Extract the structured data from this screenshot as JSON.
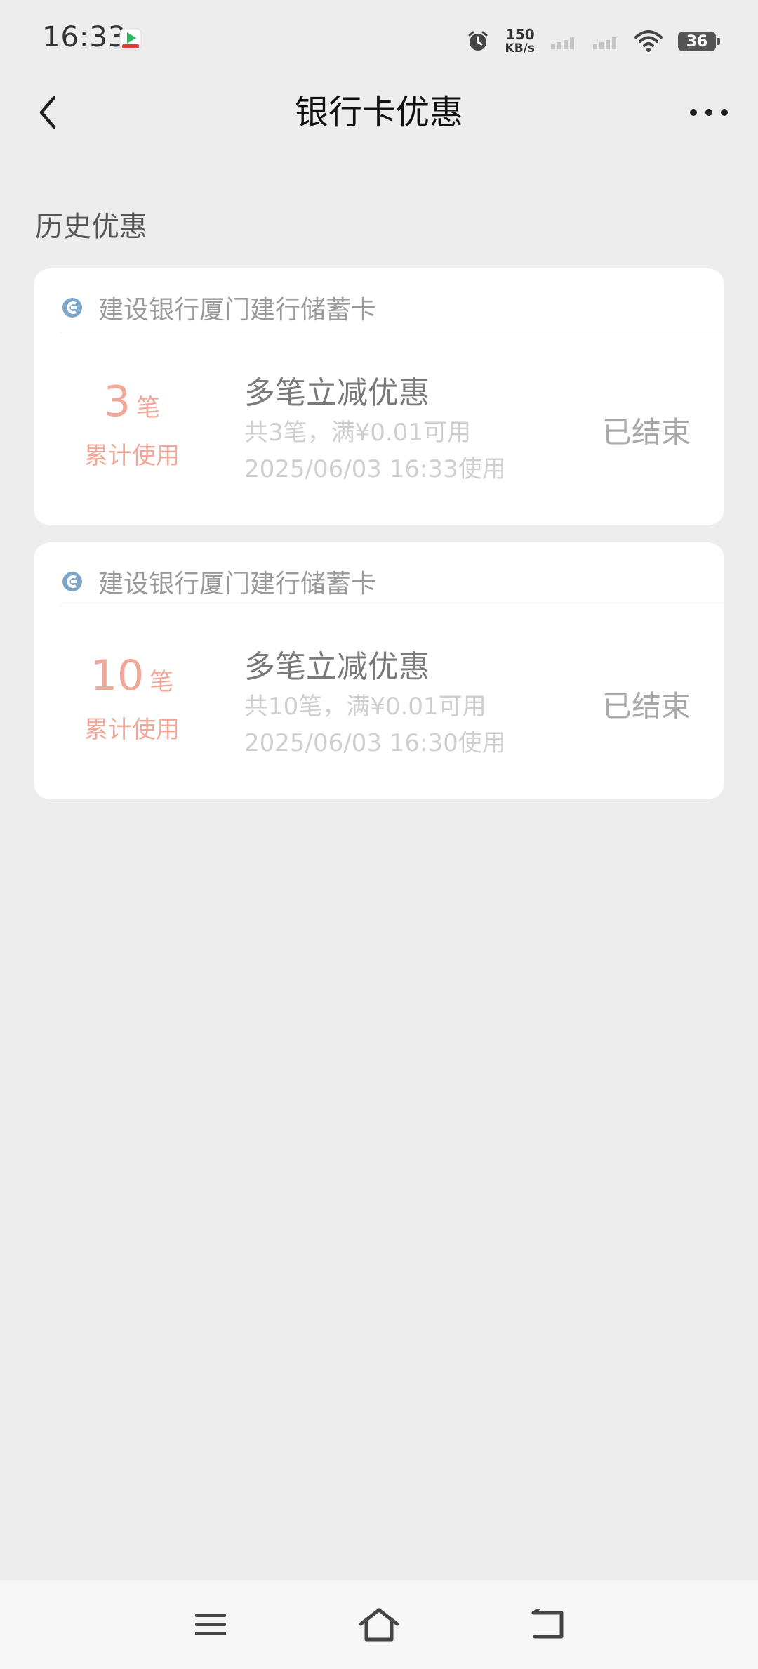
{
  "status_bar": {
    "time": "16:33",
    "speed_value": "150",
    "speed_unit": "KB/s",
    "battery": "36"
  },
  "header": {
    "title": "银行卡优惠"
  },
  "section": {
    "title": "历史优惠"
  },
  "cards": [
    {
      "bank_name": "建设银行厦门建行储蓄卡",
      "count": "3",
      "count_unit": "笔",
      "count_label": "累计使用",
      "offer_title": "多笔立减优惠",
      "offer_desc": "共3笔，满¥0.01可用",
      "offer_time": "2025/06/03 16:33使用",
      "status": "已结束"
    },
    {
      "bank_name": "建设银行厦门建行储蓄卡",
      "count": "10",
      "count_unit": "笔",
      "count_label": "累计使用",
      "offer_title": "多笔立减优惠",
      "offer_desc": "共10笔，满¥0.01可用",
      "offer_time": "2025/06/03 16:30使用",
      "status": "已结束"
    }
  ],
  "colors": {
    "accent_count": "#f2a898",
    "bank_icon": "#7ea6c8",
    "background": "#ededed"
  }
}
